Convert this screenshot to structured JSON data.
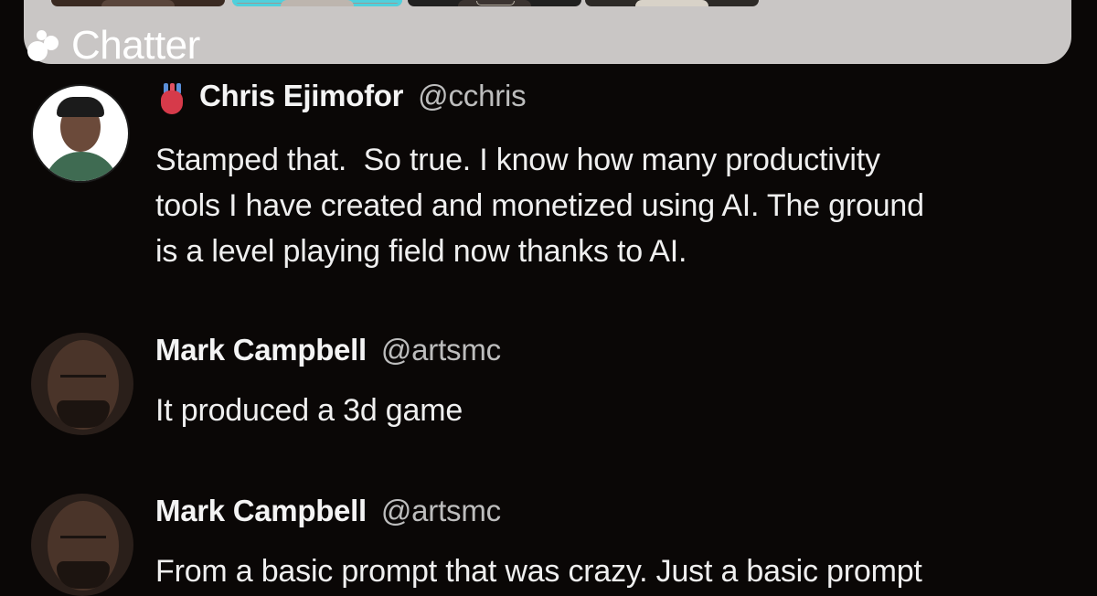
{
  "app": {
    "name": "Chatter"
  },
  "video_strip": {
    "tiles": [
      {
        "label": "participant-1",
        "active": false
      },
      {
        "label": "participant-2",
        "active": true
      },
      {
        "label": "participant-3",
        "active": false
      },
      {
        "label": "participant-4",
        "active": false
      }
    ],
    "accent_color": "#4fd0dc"
  },
  "messages": [
    {
      "author": "Chris Ejimofor",
      "handle": "@cchris",
      "badge_icon": "anatomical-heart-icon",
      "text": "Stamped that.  So true. I know how many productivity\ntools I have created and monetized using AI. The ground\nis a level playing field now thanks to AI."
    },
    {
      "author": "Mark Campbell",
      "handle": "@artsmc",
      "text": "It produced a 3d game"
    },
    {
      "author": "Mark Campbell",
      "handle": "@artsmc",
      "text": "From a basic prompt that was crazy. Just a basic prompt"
    }
  ],
  "colors": {
    "background": "#0a0706",
    "text": "#efefef",
    "handle": "#bdbdbd",
    "strip": "#c9c6c5"
  }
}
